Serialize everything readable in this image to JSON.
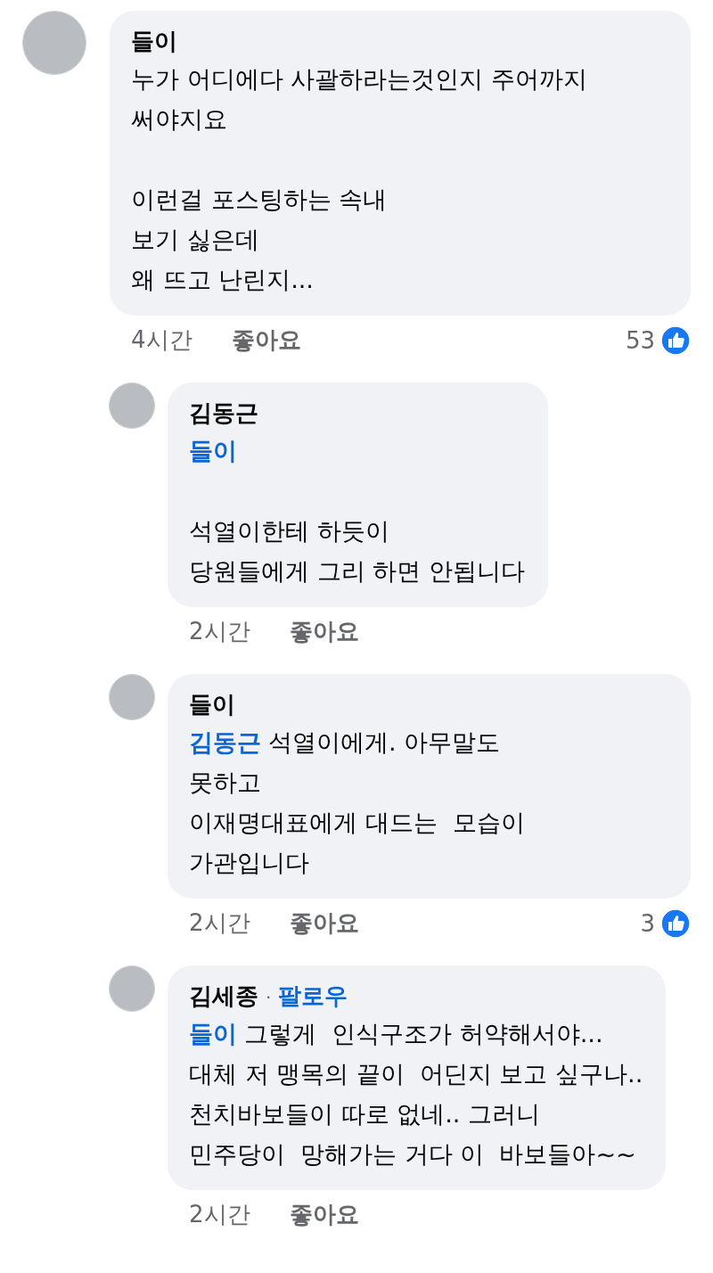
{
  "comments": [
    {
      "author": "들이",
      "paragraphs": [
        [
          {
            "text": "누가 어디에다 사괄하라는것인지 주어까지"
          },
          {
            "text": "써야지요"
          }
        ],
        [
          {
            "text": "이런걸 포스팅하는 속내"
          },
          {
            "text": "보기 싫은데"
          },
          {
            "text": "왜 뜨고 난린지..."
          }
        ]
      ],
      "time": "4시간",
      "like_label": "좋아요",
      "reactions": "53",
      "children": [
        {
          "author": "김동근",
          "paragraphs": [
            [
              {
                "mention": "들이"
              }
            ],
            [
              {
                "text": "석열이한테 하듯이"
              },
              {
                "text": "당원들에게 그리 하면 안됩니다"
              }
            ]
          ],
          "time": "2시간",
          "like_label": "좋아요"
        },
        {
          "author": "들이",
          "paragraphs": [
            [
              {
                "mention": "김동근",
                "text": "석열이에게. 아무말도"
              },
              {
                "text": "못하고"
              },
              {
                "text": "이재명대표에게 대드는  모습이"
              },
              {
                "text": "가관입니다"
              }
            ]
          ],
          "time": "2시간",
          "like_label": "좋아요",
          "reactions": "3"
        },
        {
          "author": "김세종",
          "separator": "·",
          "follow": "팔로우",
          "paragraphs": [
            [
              {
                "mention": "들이",
                "text": "그렇게  인식구조가 허약해서야..."
              },
              {
                "text": "대체 저 맹목의 끝이  어딘지 보고 싶구나.."
              },
              {
                "text": "천치바보들이 따로 없네.. 그러니"
              },
              {
                "text": "민주당이  망해가는 거다 이  바보들아~~"
              }
            ]
          ],
          "time": "2시간",
          "like_label": "좋아요"
        }
      ]
    }
  ]
}
